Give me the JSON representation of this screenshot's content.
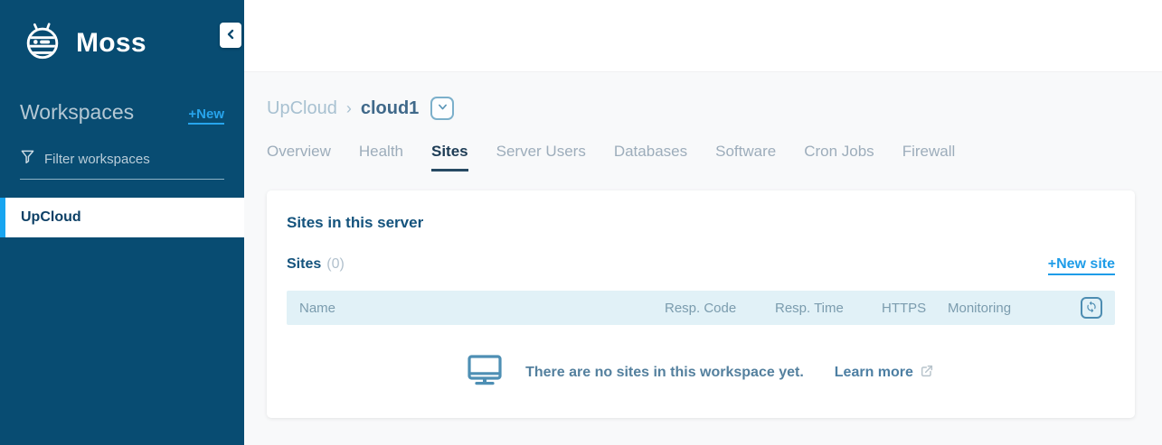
{
  "app": {
    "name": "Moss"
  },
  "sidebar": {
    "workspaces_heading": "Workspaces",
    "new_workspace_link": "+New",
    "filter_placeholder": "Filter workspaces",
    "items": [
      {
        "label": "UpCloud"
      }
    ]
  },
  "breadcrumb": {
    "workspace": "UpCloud",
    "separator": "›",
    "server": "cloud1"
  },
  "tabs": {
    "items": [
      "Overview",
      "Health",
      "Sites",
      "Server Users",
      "Databases",
      "Software",
      "Cron Jobs",
      "Firewall"
    ],
    "active": "Sites"
  },
  "card": {
    "title": "Sites in this server",
    "sites_label": "Sites",
    "sites_count": "(0)",
    "new_site_link": "+New site",
    "table": {
      "columns": [
        "Name",
        "Resp. Code",
        "Resp. Time",
        "HTTPS",
        "Monitoring"
      ]
    },
    "empty_state": {
      "message": "There are no sites in this workspace yet.",
      "learn_more_label": "Learn more"
    }
  },
  "icons": {
    "logo": "moss-robot-icon",
    "collapse": "chevron-left-icon",
    "filter": "funnel-icon",
    "breadcrumb_dropdown": "chevron-down-icon",
    "table_refresh": "refresh-icon",
    "empty": "monitor-icon",
    "learn_more": "external-link-icon"
  },
  "colors": {
    "sidebar_bg": "#084C72",
    "accent_blue": "#1E9CE8",
    "selected_item_accent": "#18A5F0",
    "table_header_bg": "#E1F1F7",
    "heading_navy": "#14537D",
    "active_tab": "#1D3C55",
    "muted_blue": "#54809E"
  }
}
